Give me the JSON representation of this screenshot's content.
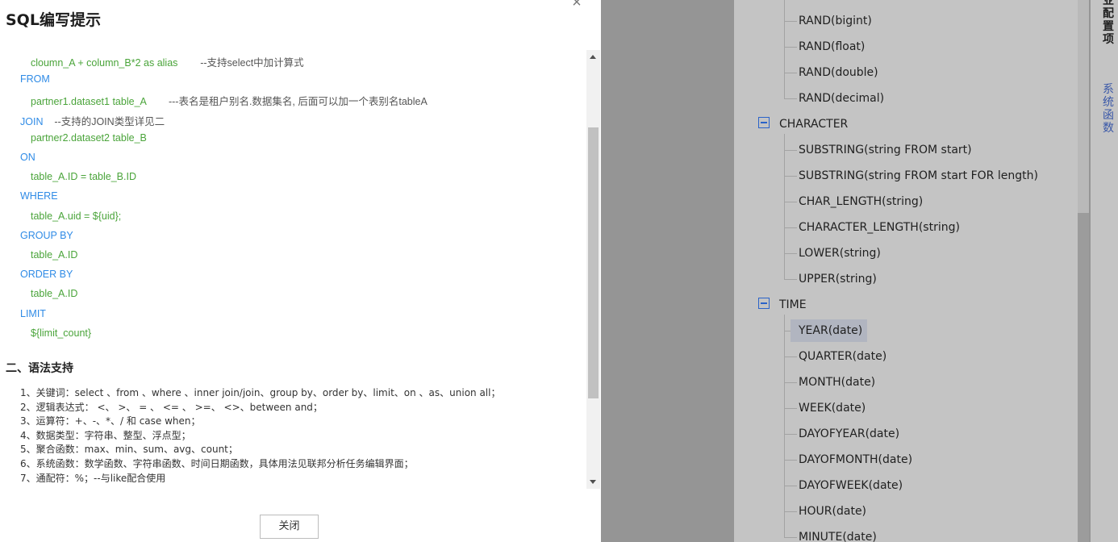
{
  "dialog": {
    "title": "SQL编写提示",
    "close_icon": "×",
    "close_button": "关闭"
  },
  "sql_lines": [
    {
      "indent": 38,
      "parts": [
        {
          "cls": "val",
          "text": "cloumn_A + column_B*2 as alias"
        },
        {
          "cls": "cmt",
          "text": "        --支持select中加计算式"
        }
      ]
    },
    {
      "indent": 25,
      "parts": [
        {
          "cls": "kw",
          "text": "FROM"
        }
      ]
    },
    {
      "indent": 38,
      "parts": [
        {
          "cls": "val",
          "text": "partner1.dataset1 table_A"
        },
        {
          "cls": "cmt",
          "text": "        ---表名是租户别名.数据集名, 后面可以加一个表别名tableA"
        }
      ]
    },
    {
      "indent": 25,
      "parts": [
        {
          "cls": "kw",
          "text": "JOIN"
        },
        {
          "cls": "cmt",
          "text": "    --支持的JOIN类型详见二"
        }
      ]
    },
    {
      "indent": 38,
      "parts": [
        {
          "cls": "val",
          "text": "partner2.dataset2 table_B"
        }
      ]
    },
    {
      "indent": 25,
      "parts": [
        {
          "cls": "kw",
          "text": "ON"
        }
      ]
    },
    {
      "indent": 38,
      "parts": [
        {
          "cls": "val",
          "text": "table_A.ID = table_B.ID"
        }
      ]
    },
    {
      "indent": 25,
      "parts": [
        {
          "cls": "kw",
          "text": "WHERE"
        }
      ]
    },
    {
      "indent": 38,
      "parts": [
        {
          "cls": "val",
          "text": "table_A.uid = ${uid};"
        }
      ]
    },
    {
      "indent": 25,
      "parts": [
        {
          "cls": "kw",
          "text": "GROUP BY"
        }
      ]
    },
    {
      "indent": 38,
      "parts": [
        {
          "cls": "val",
          "text": "table_A.ID"
        }
      ]
    },
    {
      "indent": 25,
      "parts": [
        {
          "cls": "kw",
          "text": "ORDER BY"
        }
      ]
    },
    {
      "indent": 38,
      "parts": [
        {
          "cls": "val",
          "text": "table_A.ID"
        }
      ]
    },
    {
      "indent": 25,
      "parts": [
        {
          "cls": "kw",
          "text": "LIMIT"
        }
      ]
    },
    {
      "indent": 38,
      "parts": [
        {
          "cls": "val",
          "text": "${limit_count}"
        }
      ]
    }
  ],
  "section2": {
    "heading": "二、语法支持",
    "items": [
      "1、关键词：select 、from 、where 、inner join/join、group by、order by、limit、on 、as、union all；",
      "2、逻辑表达式： <、 >、 = 、 <= 、 >=、 <>、between and；",
      "3、运算符：+、-、*、/ 和 case when；",
      "4、数据类型：字符串、整型、浮点型；",
      "5、聚合函数：max、min、sum、avg、count；",
      "6、系统函数：数学函数、字符串函数、时间日期函数，具体用法见联邦分析任务编辑界面；",
      "7、通配符：%；--与like配合使用"
    ]
  },
  "tree": {
    "top_items": [
      "RAND(bigint)",
      "RAND(float)",
      "RAND(double)",
      "RAND(decimal)"
    ],
    "groups": [
      {
        "label": "CHARACTER",
        "items": [
          "SUBSTRING(string FROM start)",
          "SUBSTRING(string FROM start FOR length)",
          "CHAR_LENGTH(string)",
          "CHARACTER_LENGTH(string)",
          "LOWER(string)",
          "UPPER(string)"
        ]
      },
      {
        "label": "TIME",
        "items": [
          "YEAR(date)",
          "QUARTER(date)",
          "MONTH(date)",
          "WEEK(date)",
          "DAYOFYEAR(date)",
          "DAYOFMONTH(date)",
          "DAYOFWEEK(date)",
          "HOUR(date)",
          "MINUTE(date)"
        ]
      }
    ],
    "highlighted": "YEAR(date)"
  },
  "side_tabs": {
    "active": "业配置项",
    "other": "系统函数"
  }
}
